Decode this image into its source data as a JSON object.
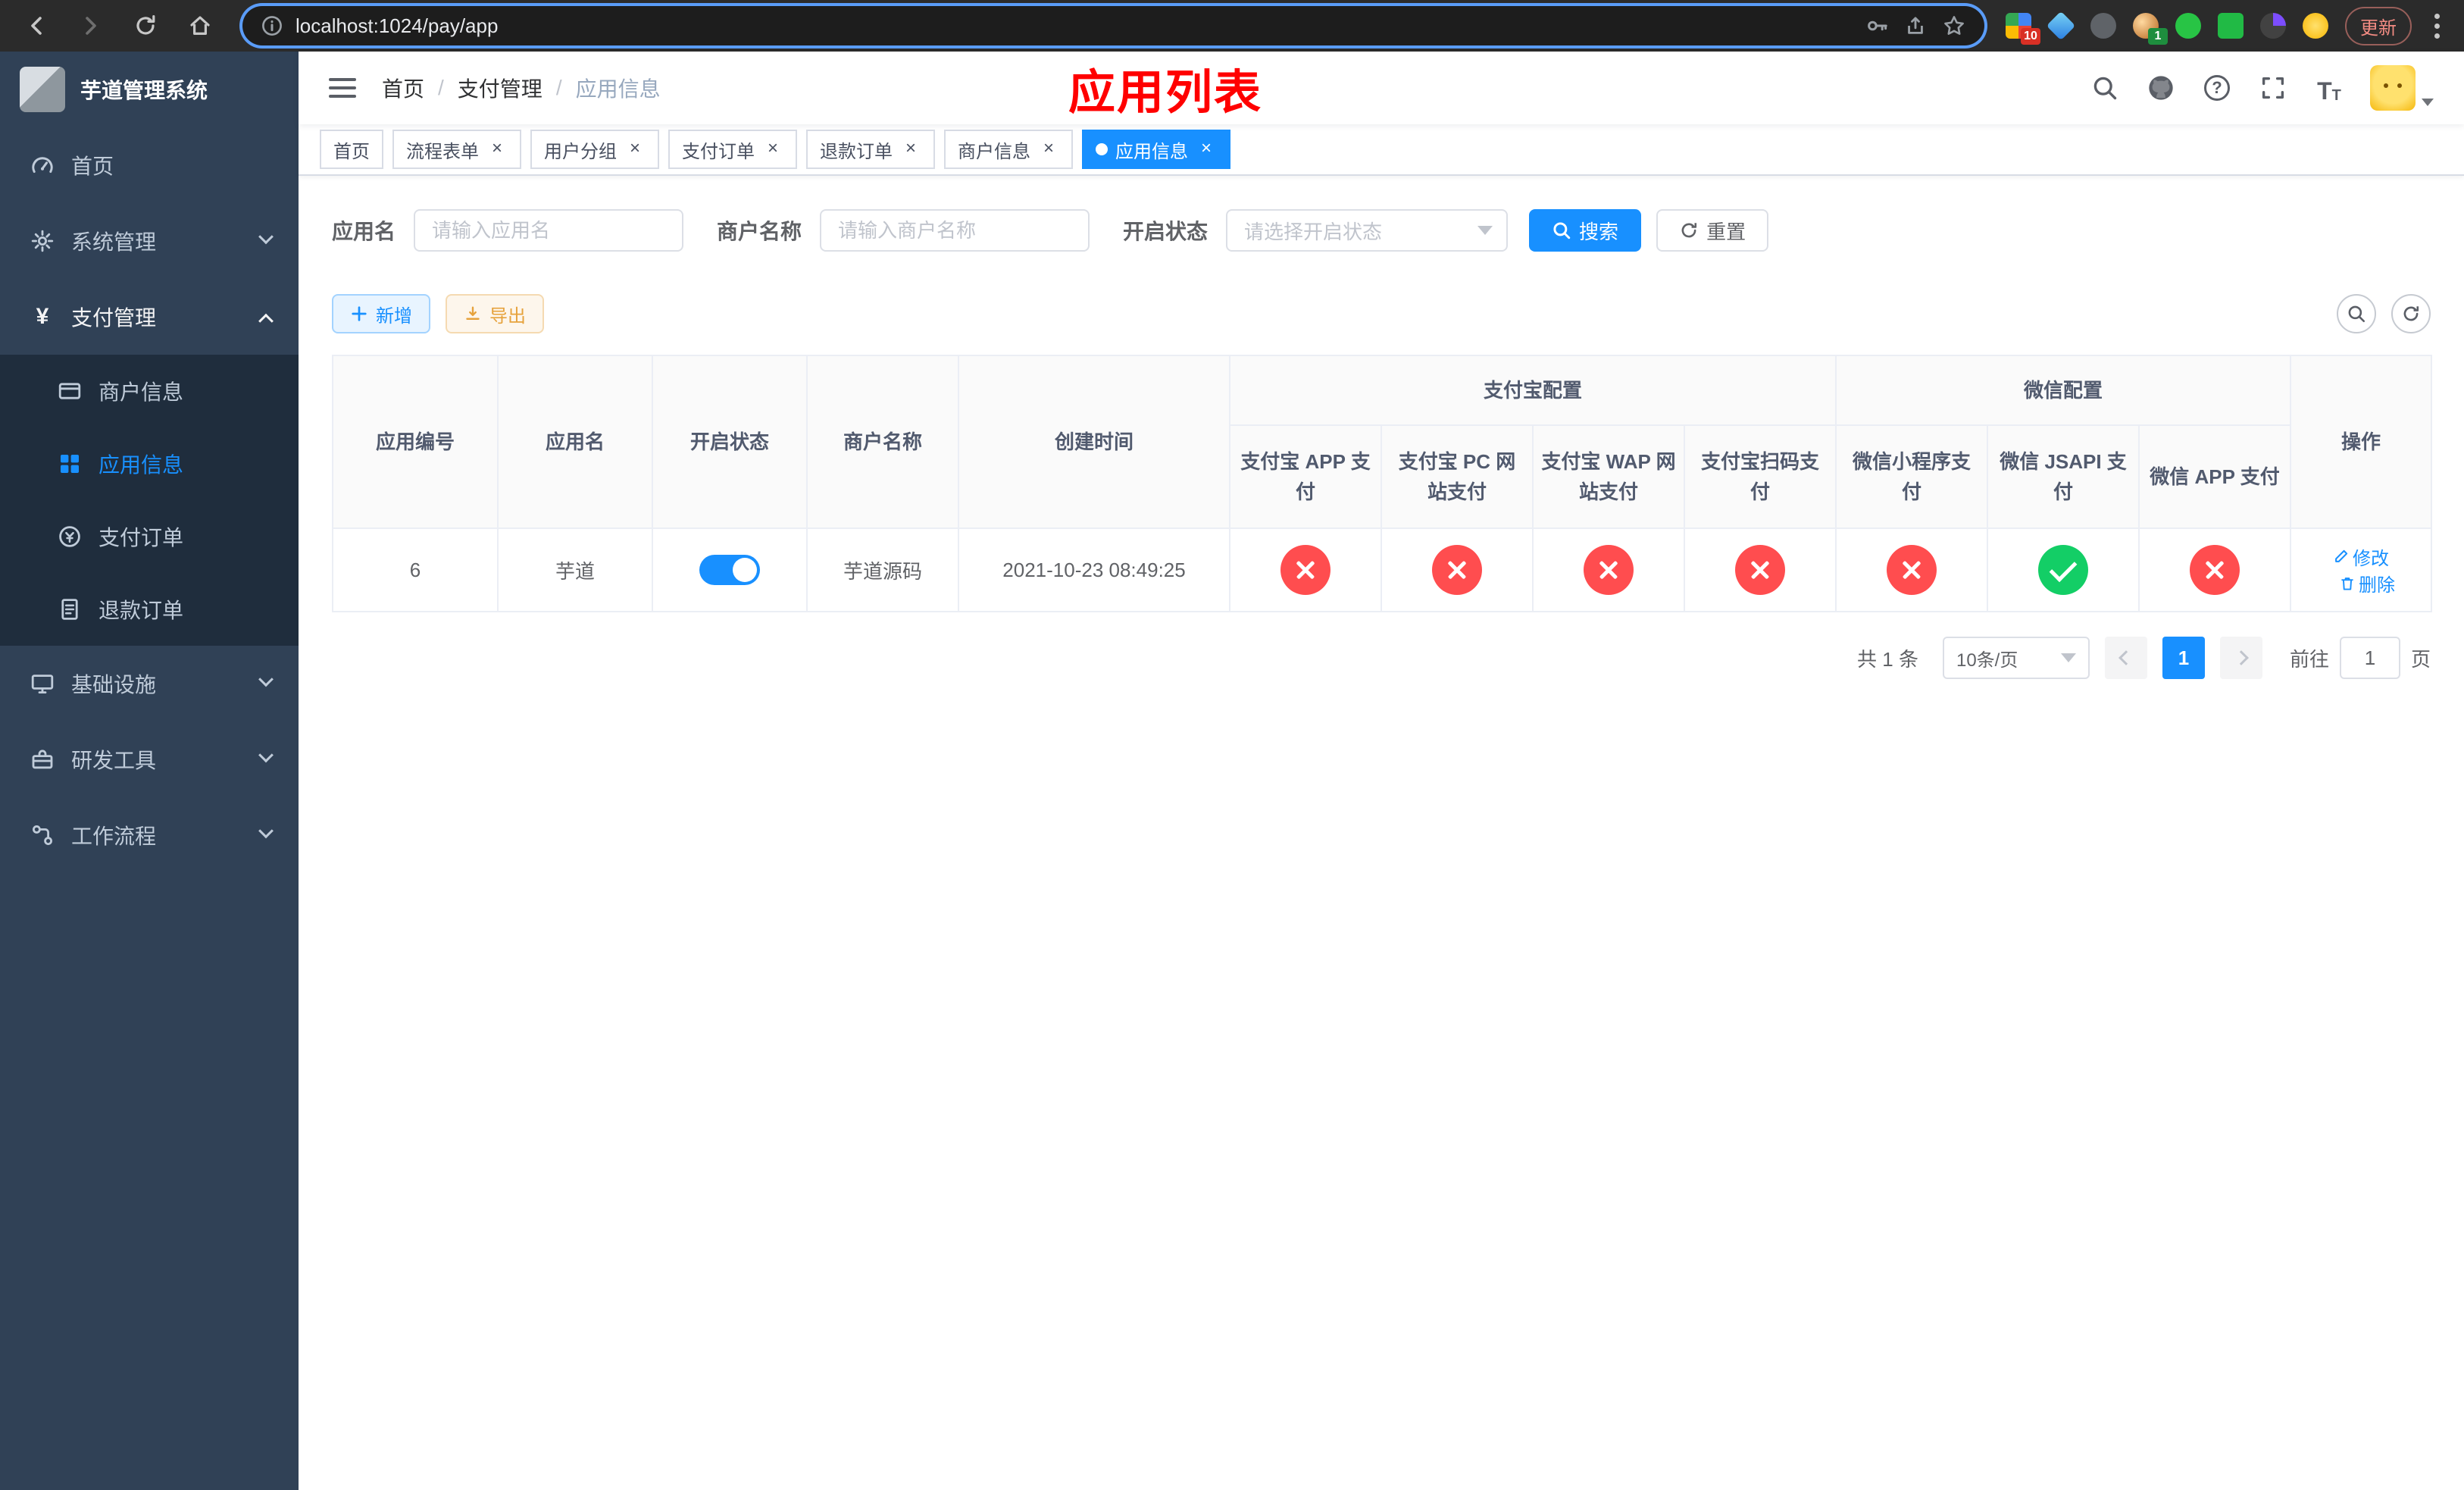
{
  "colors": {
    "accent": "#1890ff",
    "danger": "#ff4d4f",
    "success": "#13ce66",
    "sidebar_bg": "#304156",
    "submenu_bg": "#1f2d3d",
    "overlay_title_color": "#ff0000"
  },
  "browser": {
    "url": "localhost:1024/pay/app",
    "update_label": "更新",
    "ext_badges": [
      "10",
      "1"
    ]
  },
  "icons": {
    "close": "×",
    "question": "?",
    "yen": "¥",
    "font_size_big": "T",
    "font_size_small": "T"
  },
  "sidebar": {
    "title": "芋道管理系统",
    "items": [
      {
        "label": "首页"
      },
      {
        "label": "系统管理"
      },
      {
        "label": "支付管理"
      },
      {
        "label": "基础设施"
      },
      {
        "label": "研发工具"
      },
      {
        "label": "工作流程"
      }
    ],
    "submenu": [
      {
        "label": "商户信息"
      },
      {
        "label": "应用信息"
      },
      {
        "label": "支付订单"
      },
      {
        "label": "退款订单"
      }
    ]
  },
  "header": {
    "breadcrumb": [
      "首页",
      "支付管理",
      "应用信息"
    ],
    "separator": "/",
    "overlay_title": "应用列表"
  },
  "tabs": {
    "items": [
      {
        "label": "首页",
        "closable": false,
        "active": false
      },
      {
        "label": "流程表单",
        "closable": true,
        "active": false
      },
      {
        "label": "用户分组",
        "closable": true,
        "active": false
      },
      {
        "label": "支付订单",
        "closable": true,
        "active": false
      },
      {
        "label": "退款订单",
        "closable": true,
        "active": false
      },
      {
        "label": "商户信息",
        "closable": true,
        "active": false
      },
      {
        "label": "应用信息",
        "closable": true,
        "active": true
      }
    ]
  },
  "filters": {
    "app_name_label": "应用名",
    "app_name_placeholder": "请输入应用名",
    "app_name_value": "",
    "merchant_label": "商户名称",
    "merchant_placeholder": "请输入商户名称",
    "merchant_value": "",
    "status_label": "开启状态",
    "status_placeholder": "请选择开启状态",
    "search_label": "搜索",
    "reset_label": "重置"
  },
  "toolbar": {
    "add_label": "新增",
    "export_label": "导出"
  },
  "table": {
    "head": {
      "app_id": "应用编号",
      "app_name": "应用名",
      "status": "开启状态",
      "merchant": "商户名称",
      "created": "创建时间",
      "alipay_group": "支付宝配置",
      "wechat_group": "微信配置",
      "ops": "操作"
    },
    "subhead": {
      "alipay_app": "支付宝 APP 支付",
      "alipay_pc": "支付宝 PC 网站支付",
      "alipay_wap": "支付宝 WAP 网站支付",
      "alipay_qr": "支付宝扫码支付",
      "wx_mini": "微信小程序支付",
      "wx_jsapi": "微信 JSAPI 支付",
      "wx_app": "微信 APP 支付"
    },
    "rows": [
      {
        "id": "6",
        "name": "芋道",
        "enabled": true,
        "merchant": "芋道源码",
        "created": "2021-10-23 08:49:25",
        "config": {
          "alipay_app": false,
          "alipay_pc": false,
          "alipay_wap": false,
          "alipay_qr": false,
          "wx_mini": false,
          "wx_jsapi": true,
          "wx_app": false
        },
        "edit_label": "修改",
        "delete_label": "删除"
      }
    ]
  },
  "pagination": {
    "total": "共 1 条",
    "page_size": "10条/页",
    "page": "1",
    "goto_label": "前往",
    "goto_value": "1",
    "unit_label": "页"
  }
}
